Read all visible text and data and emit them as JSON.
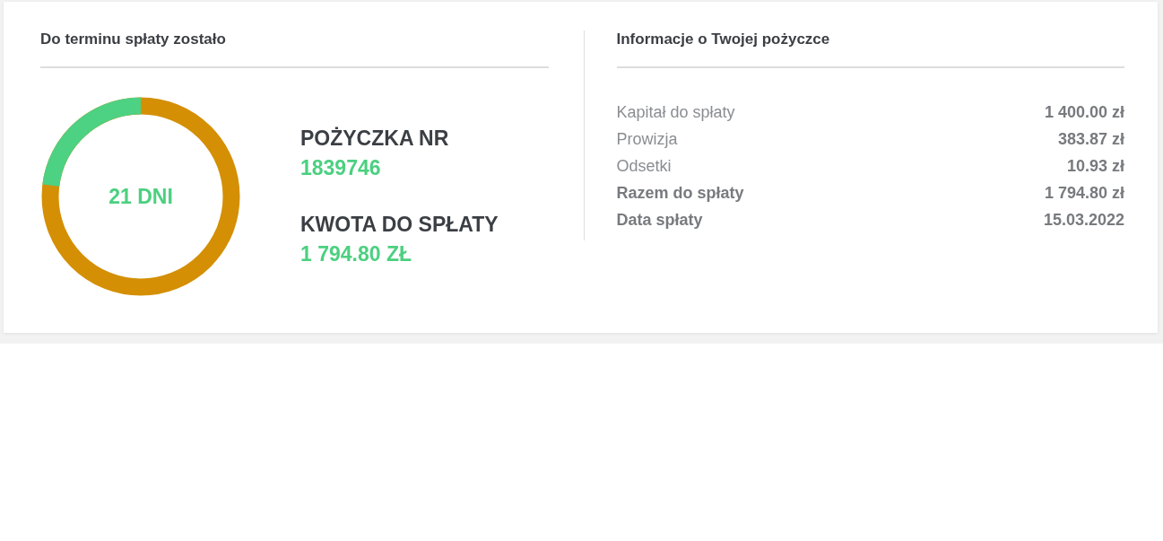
{
  "countdown": {
    "title": "Do terminu spłaty zostało",
    "ring": {
      "label": "21 DNI"
    },
    "facts": [
      {
        "heading": "POŻYCZKA NR",
        "value": "1839746"
      },
      {
        "heading": "KWOTA DO SPŁATY",
        "value": "1 794.80 ZŁ"
      }
    ]
  },
  "loan_info": {
    "title": "Informacje o Twojej pożyczce",
    "rows": [
      {
        "label": "Kapitał do spłaty",
        "value": "1 400.00 zł",
        "emphasized": false
      },
      {
        "label": "Prowizja",
        "value": "383.87 zł",
        "emphasized": false
      },
      {
        "label": "Odsetki",
        "value": "10.93 zł",
        "emphasized": false
      },
      {
        "label": "Razem do spłaty",
        "value": "1 794.80 zł",
        "emphasized": true
      },
      {
        "label": "Data spłaty",
        "value": "15.03.2022",
        "emphasized": true
      }
    ]
  }
}
